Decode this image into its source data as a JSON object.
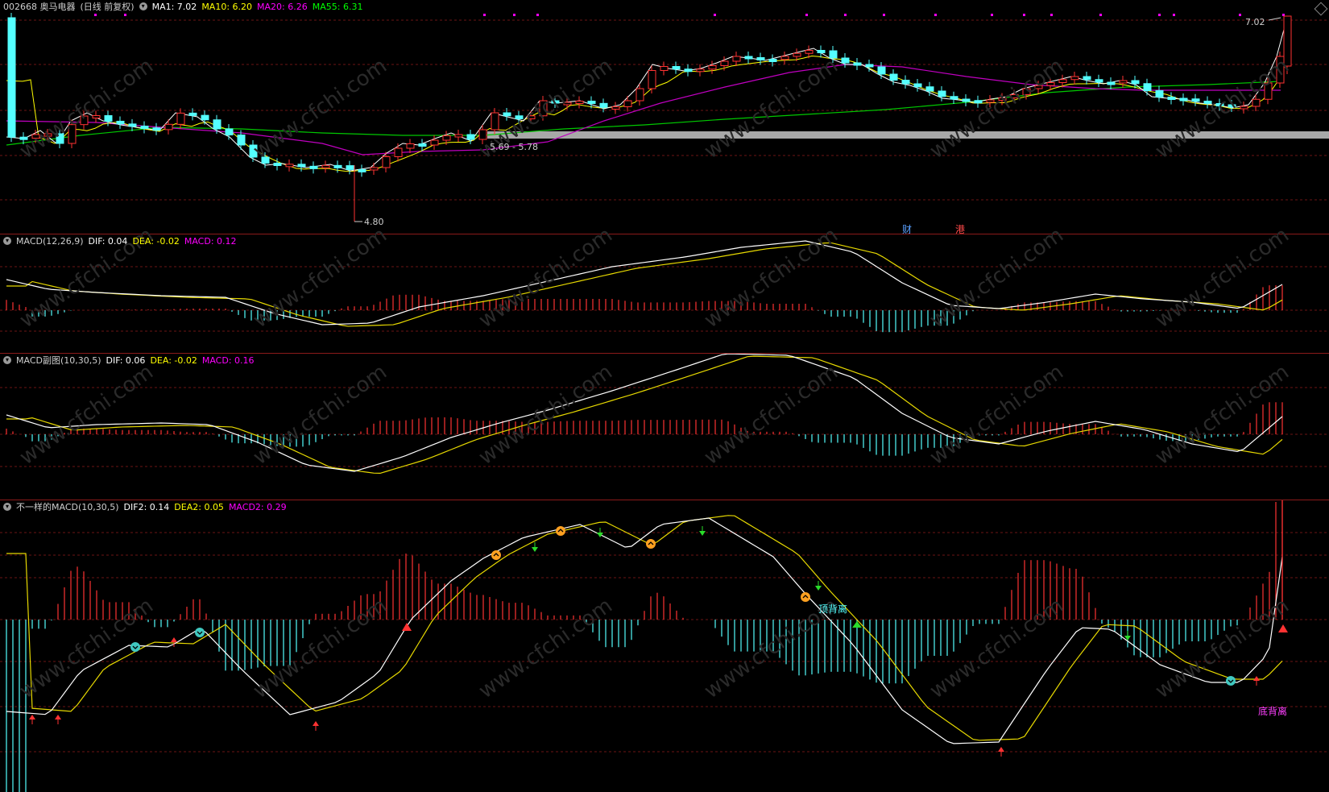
{
  "main": {
    "stock_label": "002668 奥马电器",
    "period_label": "(日线 前复权)",
    "ma": [
      {
        "label": "MA1: 7.02",
        "color": "#ffffff"
      },
      {
        "label": "MA10: 6.20",
        "color": "#ffff00"
      },
      {
        "label": "MA20: 6.26",
        "color": "#ff00ff"
      },
      {
        "label": "MA55: 6.31",
        "color": "#00ff00"
      }
    ],
    "high_label": "7.02",
    "low_label": "4.80",
    "range_label": "5.69 - 5.78",
    "marker_cai": "财",
    "marker_gang": "港"
  },
  "macd1": {
    "name": "MACD(12,26,9)",
    "dif": "DIF: 0.04",
    "dea": "DEA: -0.02",
    "macd": "MACD: 0.12"
  },
  "macd2": {
    "name": "MACD副图(10,30,5)",
    "dif": "DIF: 0.06",
    "dea": "DEA: -0.02",
    "macd": "MACD: 0.16"
  },
  "macd3": {
    "name": "不一样的MACD(10,30,5)",
    "dif": "DIF2: 0.14",
    "dea": "DEA2: 0.05",
    "macd": "MACD2: 0.29",
    "top_divergence": "顶背离",
    "bottom_divergence": "底背离"
  },
  "watermark": "www.cfchi.com",
  "colors": {
    "up": "#ff3232",
    "down": "#54ffff",
    "dif": "#ffffff",
    "dea": "#ffff00",
    "grid": "#8b1a1a"
  }
}
